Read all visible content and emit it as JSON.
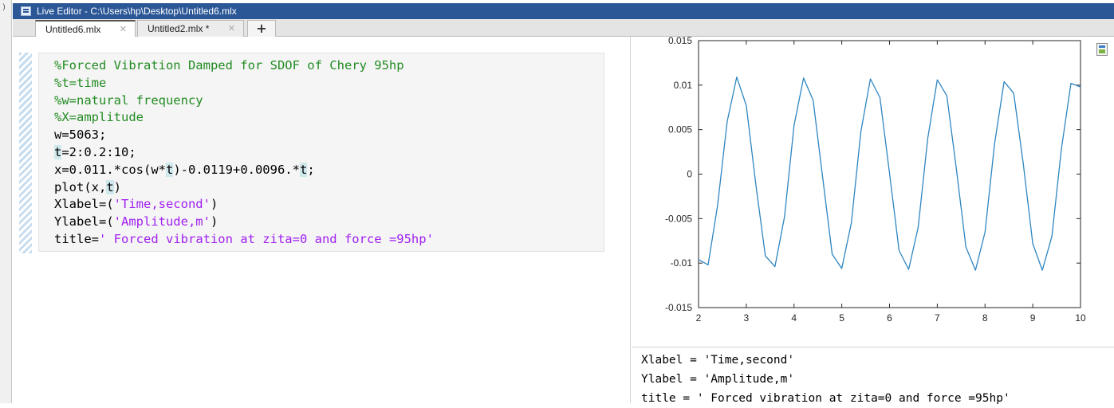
{
  "window": {
    "title": "Live Editor - C:\\Users\\hp\\Desktop\\Untitled6.mlx",
    "left_chevron": ")"
  },
  "tabs": [
    {
      "label": "Untitled6.mlx",
      "close": "✕",
      "active": true
    },
    {
      "label": "Untitled2.mlx *",
      "close": "✕",
      "active": false
    }
  ],
  "add_tab_label": "+",
  "code": {
    "l1": "%Forced Vibration Damped for SDOF of Chery 95hp",
    "l2": "%t=time",
    "l3": "%w=natural frequency",
    "l4": "%X=amplitude",
    "l5": "w=5063;",
    "l6_var": "t",
    "l6_rest": "=2:0.2:10;",
    "l7_a": "x=0.011.*cos(w*",
    "l7_var1": "t",
    "l7_b": ")-0.0119+0.0096.*",
    "l7_var2": "t",
    "l7_c": ";",
    "l8_a": "plot(x,",
    "l8_var": "t",
    "l8_c": ")",
    "l9_a": "Xlabel=(",
    "l9_str": "'Time,second'",
    "l9_c": ")",
    "l10_a": "Ylabel=(",
    "l10_str": "'Amplitude,m'",
    "l10_c": ")",
    "l11_a": "title=",
    "l11_str": "' Forced vibration at zita=0 and force =95hp'"
  },
  "output": {
    "xlabel": "Xlabel = 'Time,second'",
    "ylabel": "Ylabel = 'Amplitude,m'",
    "title": "title = ' Forced vibration at zita=0 and force =95hp'"
  },
  "colors": {
    "comment": "#228b22",
    "string": "#a020f0",
    "line": "#2e86c1",
    "titlebar": "#2b5797"
  },
  "icons": {
    "figure_button": "figure-toolbar-icon",
    "tab_close": "close-icon",
    "app": "live-editor-icon"
  },
  "chart_data": {
    "type": "line",
    "title": "",
    "xlabel": "",
    "ylabel": "",
    "xlim": [
      2,
      10
    ],
    "ylim": [
      -0.015,
      0.015
    ],
    "xticks": [
      2,
      3,
      4,
      5,
      6,
      7,
      8,
      9,
      10
    ],
    "yticks": [
      0.015,
      0.01,
      0.005,
      0,
      -0.005,
      -0.01,
      -0.015
    ],
    "ytick_labels": [
      "0.015",
      "0.01",
      "0.005",
      "0",
      "-0.005",
      "-0.01",
      "-0.015"
    ],
    "grid": false,
    "legend": "none",
    "series": [
      {
        "x": [
          2.0,
          2.2,
          2.4,
          2.6,
          2.8,
          3.0,
          3.2,
          3.4,
          3.6,
          3.8,
          4.0,
          4.2,
          4.4,
          4.6,
          4.8,
          5.0,
          5.2,
          5.4,
          5.6,
          5.8,
          6.0,
          6.2,
          6.4,
          6.6,
          6.8,
          7.0,
          7.2,
          7.4,
          7.6,
          7.8,
          8.0,
          8.2,
          8.4,
          8.6,
          8.8,
          9.0,
          9.2,
          9.4,
          9.6,
          9.8,
          10.0
        ],
        "y": [
          -0.0096,
          -0.0102,
          -0.0035,
          0.0059,
          0.0109,
          0.0077,
          -0.0012,
          -0.0092,
          -0.0104,
          -0.0048,
          0.0055,
          0.0108,
          0.0083,
          -0.0004,
          -0.009,
          -0.0106,
          -0.0055,
          0.0048,
          0.0107,
          0.0086,
          0.0001,
          -0.0086,
          -0.0107,
          -0.006,
          0.004,
          0.0106,
          0.0088,
          0.0006,
          -0.0082,
          -0.0108,
          -0.0065,
          0.0034,
          0.0104,
          0.0091,
          0.0012,
          -0.0078,
          -0.0108,
          -0.007,
          0.0028,
          0.0102,
          0.0098
        ]
      }
    ]
  }
}
